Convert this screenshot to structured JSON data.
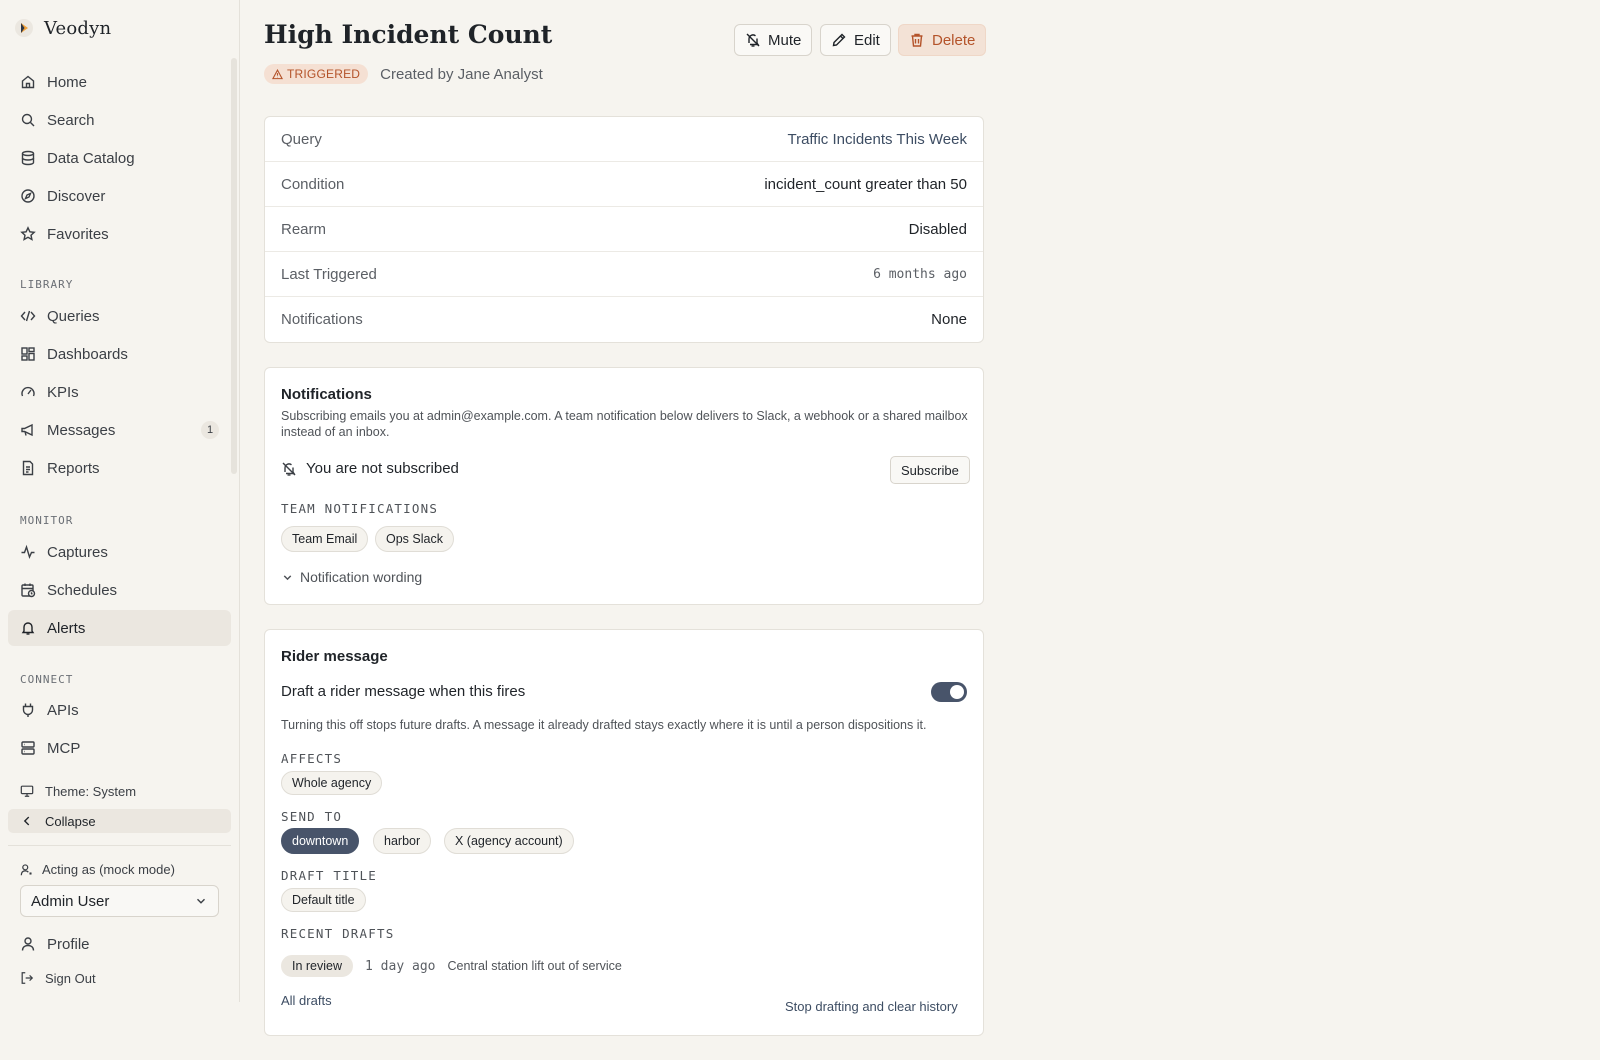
{
  "brand": {
    "name": "Veodyn",
    "accent": "#f0a23c"
  },
  "sidebar": {
    "primary": [
      {
        "label": "Home",
        "icon": "home-icon"
      },
      {
        "label": "Search",
        "icon": "search-icon"
      },
      {
        "label": "Data Catalog",
        "icon": "database-icon"
      },
      {
        "label": "Discover",
        "icon": "compass-icon"
      },
      {
        "label": "Favorites",
        "icon": "star-icon"
      }
    ],
    "library_label": "LIBRARY",
    "library": [
      {
        "label": "Queries",
        "icon": "code-icon"
      },
      {
        "label": "Dashboards",
        "icon": "dashboard-icon"
      },
      {
        "label": "KPIs",
        "icon": "gauge-icon"
      },
      {
        "label": "Messages",
        "icon": "megaphone-icon",
        "badge": "1"
      },
      {
        "label": "Reports",
        "icon": "report-icon"
      }
    ],
    "monitor_label": "MONITOR",
    "monitor": [
      {
        "label": "Captures",
        "icon": "activity-icon"
      },
      {
        "label": "Schedules",
        "icon": "calendar-clock-icon"
      },
      {
        "label": "Alerts",
        "icon": "bell-icon",
        "active": true
      }
    ],
    "connect_label": "CONNECT",
    "connect": [
      {
        "label": "APIs",
        "icon": "plug-icon"
      },
      {
        "label": "MCP",
        "icon": "server-icon"
      }
    ],
    "theme_label": "Theme: System",
    "collapse_label": "Collapse",
    "acting_label": "Acting as (mock mode)",
    "acting_user": "Admin User",
    "profile_label": "Profile",
    "signout_label": "Sign Out"
  },
  "header": {
    "title": "High Incident Count",
    "mute_label": "Mute",
    "edit_label": "Edit",
    "delete_label": "Delete",
    "status": "TRIGGERED",
    "created_by": "Created by Jane Analyst"
  },
  "properties": [
    {
      "key": "Query",
      "value": "Traffic Incidents This Week"
    },
    {
      "key": "Condition",
      "value": "incident_count greater than 50"
    },
    {
      "key": "Rearm",
      "value": "Disabled"
    },
    {
      "key": "Last Triggered",
      "value": "6 months ago"
    },
    {
      "key": "Notifications",
      "value": "None"
    }
  ],
  "notifications": {
    "title": "Notifications",
    "description": "Subscribing emails you at admin@example.com. A team notification below delivers to Slack, a webhook or a shared mailbox instead of an inbox.",
    "subscription_status": "You are not subscribed",
    "subscribe_label": "Subscribe",
    "team_label": "TEAM NOTIFICATIONS",
    "teams": [
      "Team Email",
      "Ops Slack"
    ],
    "wording_label": "Notification wording"
  },
  "rider": {
    "title": "Rider message",
    "toggle_label": "Draft a rider message when this fires",
    "toggle_on": true,
    "description": "Turning this off stops future drafts. A message it already drafted stays exactly where it is until a person dispositions it.",
    "affects_label": "AFFECTS",
    "affects_value": "Whole agency",
    "send_to_label": "SEND TO",
    "send_to": [
      {
        "label": "downtown",
        "selected": true
      },
      {
        "label": "harbor",
        "selected": false
      },
      {
        "label": "X (agency account)",
        "selected": false
      }
    ],
    "draft_title_label": "DRAFT TITLE",
    "draft_title_value": "Default title",
    "recent_label": "RECENT DRAFTS",
    "recent": [
      {
        "status": "In review",
        "age": "1 day ago",
        "text": "Central station lift out of service"
      }
    ],
    "all_drafts_label": "All drafts",
    "stop_label": "Stop drafting and clear history"
  }
}
